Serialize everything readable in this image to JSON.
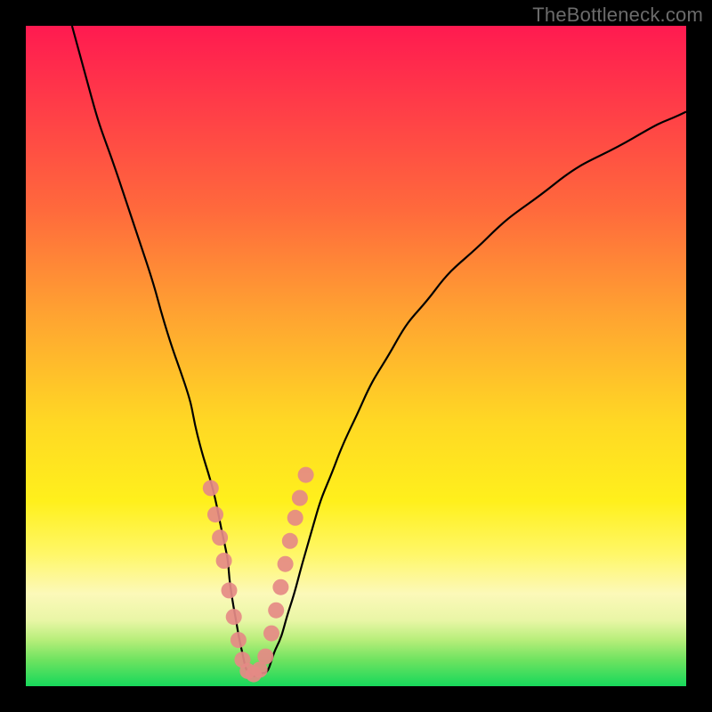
{
  "watermark": "TheBottleneck.com",
  "chart_data": {
    "type": "line",
    "title": "",
    "xlabel": "",
    "ylabel": "",
    "xlim": [
      0,
      100
    ],
    "ylim": [
      0,
      100
    ],
    "grid": false,
    "legend": false,
    "description": "V-shaped bottleneck curve over rainbow gradient; datapoint markers cluster near the valley",
    "series": [
      {
        "name": "bottleneck-curve",
        "stroke": "#000000",
        "x": [
          7,
          10,
          14,
          18,
          21,
          24,
          26,
          28,
          30,
          31,
          32,
          33,
          34,
          36,
          38,
          40,
          42,
          44,
          47,
          51,
          56,
          62,
          70,
          80,
          92,
          100
        ],
        "y": [
          100,
          89,
          77,
          65,
          55,
          46,
          38,
          31,
          22,
          15,
          9,
          4,
          2,
          2,
          6,
          12,
          19,
          26,
          34,
          43,
          52,
          60,
          68,
          76,
          83,
          87
        ]
      },
      {
        "name": "datapoints",
        "marker_color": "#e58a86",
        "x": [
          28.0,
          28.7,
          29.4,
          30.0,
          30.8,
          31.5,
          32.2,
          32.8,
          33.6,
          34.5,
          35.4,
          36.3,
          37.2,
          37.9,
          38.6,
          39.3,
          40.0,
          40.8,
          41.5,
          42.4
        ],
        "y": [
          30.0,
          26.0,
          22.5,
          19.0,
          14.5,
          10.5,
          7.0,
          4.0,
          2.3,
          1.8,
          2.5,
          4.5,
          8.0,
          11.5,
          15.0,
          18.5,
          22.0,
          25.5,
          28.5,
          32.0
        ]
      }
    ]
  }
}
